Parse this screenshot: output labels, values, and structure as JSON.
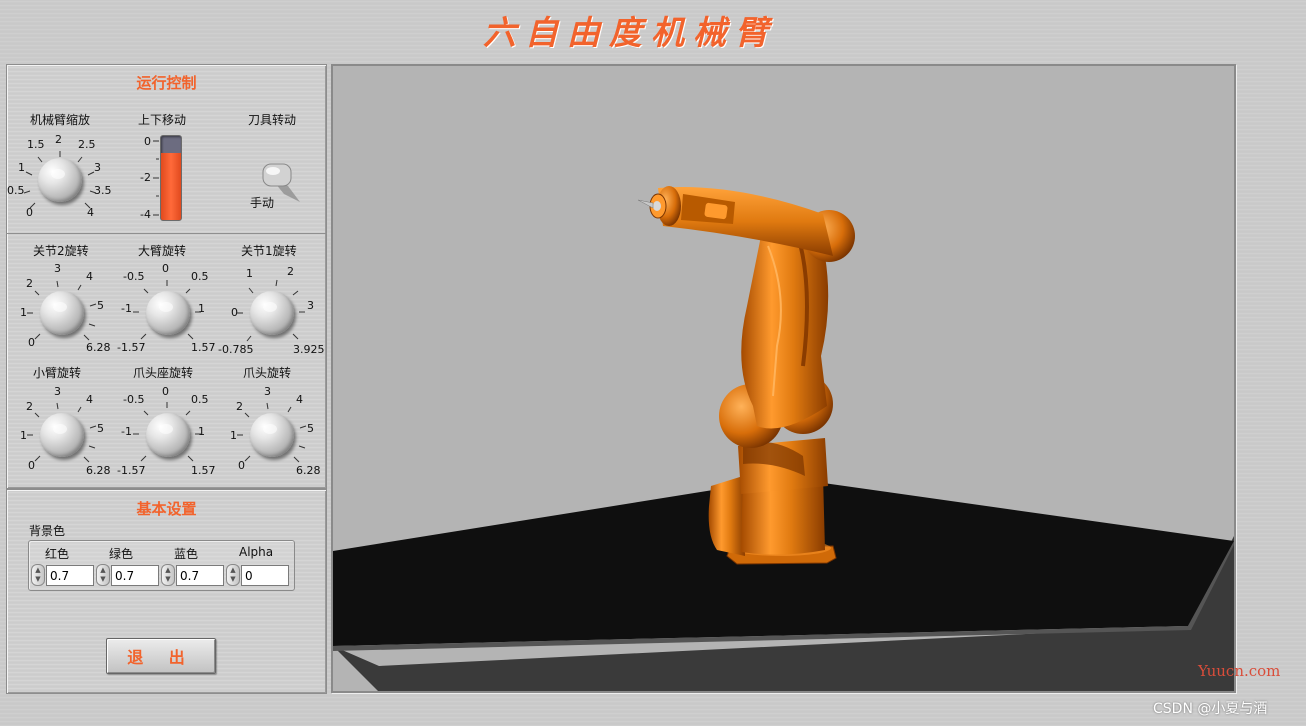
{
  "app": {
    "title": "六自由度机械臂"
  },
  "run_control": {
    "title": "运行控制",
    "arm_scale": {
      "label": "机械臂缩放",
      "ticks": [
        "0",
        "0.5",
        "1",
        "1.5",
        "2",
        "2.5",
        "3",
        "3.5",
        "4"
      ],
      "value": 2
    },
    "up_down": {
      "label": "上下移动",
      "ticks": [
        "0",
        "-2",
        "-4"
      ],
      "value": -0.8,
      "min": -4,
      "max": 0
    },
    "tool_rotate": {
      "label": "刀具转动",
      "mode": "手动"
    },
    "joint2": {
      "label": "关节2旋转",
      "ticks": [
        "0",
        "1",
        "2",
        "3",
        "4",
        "5",
        "6.28"
      ]
    },
    "big_arm": {
      "label": "大臂旋转",
      "ticks": [
        "-1.57",
        "-1",
        "-0.5",
        "0",
        "0.5",
        "1",
        "1.57"
      ]
    },
    "joint1": {
      "label": "关节1旋转",
      "ticks": [
        "-0.785",
        "0",
        "1",
        "2",
        "3",
        "3.925"
      ]
    },
    "small_arm": {
      "label": "小臂旋转",
      "ticks": [
        "0",
        "1",
        "2",
        "3",
        "4",
        "5",
        "6.28"
      ]
    },
    "claw_base": {
      "label": "爪头座旋转",
      "ticks": [
        "-1.57",
        "-1",
        "-0.5",
        "0",
        "0.5",
        "1",
        "1.57"
      ]
    },
    "claw_head": {
      "label": "爪头旋转",
      "ticks": [
        "0",
        "1",
        "2",
        "3",
        "4",
        "5",
        "6.28"
      ]
    }
  },
  "basic_settings": {
    "title": "基本设置",
    "bg_label": "背景色",
    "red": {
      "label": "红色",
      "value": "0.7"
    },
    "green": {
      "label": "绿色",
      "value": "0.7"
    },
    "blue": {
      "label": "蓝色",
      "value": "0.7"
    },
    "alpha": {
      "label": "Alpha",
      "value": "0"
    }
  },
  "exit": {
    "label": "退 出"
  },
  "watermarks": {
    "yuucn": "Yuucn.com",
    "csdn": "CSDN @小夏与酒"
  },
  "colors": {
    "accent": "#f2632c",
    "robot": "#e07a10",
    "scene_bg": "#b4b4b4",
    "floor": "#0f0f0f"
  },
  "icons": {
    "knob": "rotary-knob",
    "slider": "vertical-slider",
    "toggle": "toggle-switch",
    "spin": "spin-arrows"
  }
}
